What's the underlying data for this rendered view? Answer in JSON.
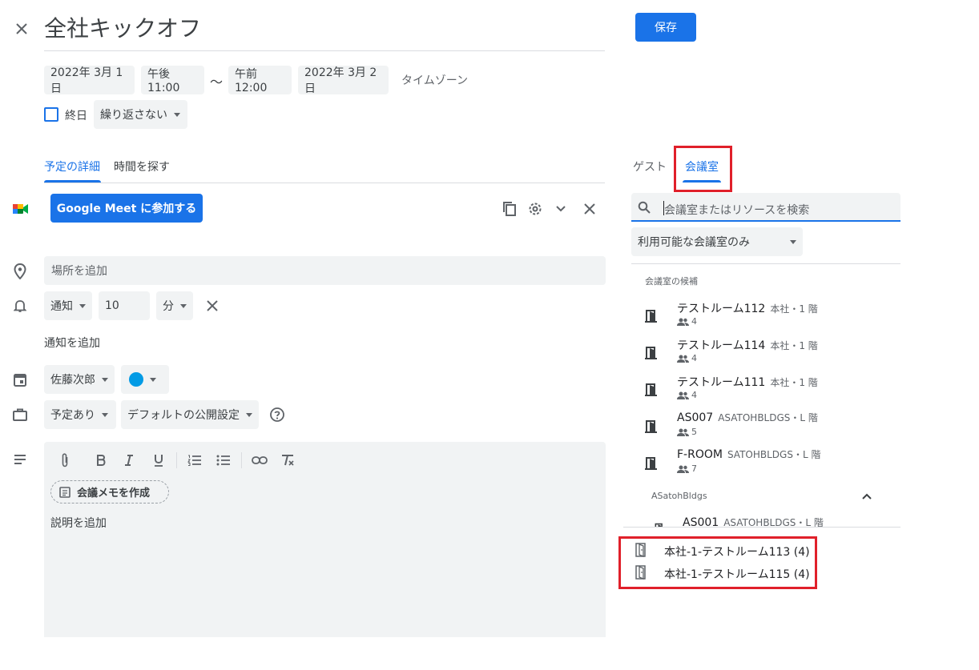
{
  "event": {
    "title": "全社キックオフ",
    "save_label": "保存",
    "start_date": "2022年 3月 1日",
    "start_time": "午後11:00",
    "range_sep": "〜",
    "end_time": "午前12:00",
    "end_date": "2022年 3月 2日",
    "timezone_label": "タイムゾーン",
    "allday_label": "終日",
    "repeat_value": "繰り返さない"
  },
  "tabs": {
    "details": "予定の詳細",
    "find_time": "時間を探す"
  },
  "meet": {
    "join_label": "Google Meet に参加する"
  },
  "location": {
    "placeholder": "場所を追加"
  },
  "notification": {
    "type": "通知",
    "value": "10",
    "unit": "分",
    "add_label": "通知を追加"
  },
  "calendar": {
    "owner": "佐藤次郎",
    "color": "#039be5"
  },
  "availability": {
    "status": "予定あり",
    "visibility": "デフォルトの公開設定"
  },
  "description": {
    "meeting_notes_label": "会議メモを作成",
    "placeholder": "説明を追加"
  },
  "right_panel": {
    "tab_guests": "ゲスト",
    "tab_rooms": "会議室",
    "search_placeholder": "会議室またはリソースを検索",
    "filter_value": "利用可能な会議室のみ",
    "suggested_header": "会議室の候補",
    "suggested_rooms": [
      {
        "name": "テストルーム112",
        "location": "本社・1 階",
        "capacity": "4"
      },
      {
        "name": "テストルーム114",
        "location": "本社・1 階",
        "capacity": "4"
      },
      {
        "name": "テストルーム111",
        "location": "本社・1 階",
        "capacity": "4"
      },
      {
        "name": "AS007",
        "location": "ASATOHBLDGS・L 階",
        "capacity": "5"
      },
      {
        "name": "F-ROOM",
        "location": "SATOHBLDGS・L 階",
        "capacity": "7"
      }
    ],
    "group_header": "ASatohBldgs",
    "group_rooms": [
      {
        "name": "AS001",
        "location": "ASATOHBLDGS・L 階"
      }
    ],
    "dropdown_results": [
      {
        "label": "本社-1-テストルーム113 (4)"
      },
      {
        "label": "本社-1-テストルーム115 (4)"
      }
    ]
  },
  "colors": {
    "accent": "#1a73e8",
    "highlight": "#e0202a",
    "chip_bg": "#f1f3f4"
  }
}
